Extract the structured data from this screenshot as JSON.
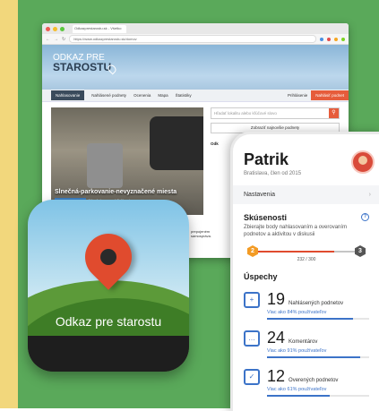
{
  "browser": {
    "tab_title": "Odkazprestarostu.sk - Všetko",
    "url": "https://www.odkazprestarostu.sk/domov",
    "logo_line1": "ODKAZ PRE",
    "logo_line2": "STAROSTU",
    "menu": [
      "Nahlasovanie",
      "Nahlásené podnety",
      "Ocenenia",
      "Mapa",
      "Štatistiky"
    ],
    "login": "Prihlásenie",
    "report_button": "Nahlásiť podnet",
    "search_placeholder": "Hľadať lokalitu alebo kľúčové slovo",
    "latest_button": "Zobraziť najnovšie podnety",
    "hero_caption": "Slnečná-parkovanie-nevyznačené miesta",
    "hero_tag": "Podnet v riešení",
    "hero_meta": "Náměstovo, pred 8 dňami",
    "side_heading": "Odk",
    "foot_text_1": "prepojeném",
    "foot_text_2": "samospráva."
  },
  "app_icon": {
    "label": "Odkaz pre starostu"
  },
  "phone": {
    "name": "Patrik",
    "subtitle": "Bratislava, člen od 2015",
    "settings_label": "Nastavenia",
    "experience_title": "Skúsenosti",
    "experience_desc": "Zbierajte body nahlasovaním a overovaním podnetov a aktivitou v diskusii",
    "level_current": "2",
    "level_next": "3",
    "points": "232 / 300",
    "points_fraction": 0.77,
    "achievements_title": "Úspechy",
    "achievements": [
      {
        "number": "19",
        "label": "Nahlásených podnetov",
        "sub": "Viac ako 84% používateľov",
        "fill": 0.84,
        "icon": "report-add-icon"
      },
      {
        "number": "24",
        "label": "Komentárov",
        "sub": "Viac ako 91% používateľov",
        "fill": 0.91,
        "icon": "comment-icon"
      },
      {
        "number": "12",
        "label": "Overených podnetov",
        "sub": "Viac ako 61% používateľov",
        "fill": 0.61,
        "icon": "verified-icon"
      }
    ]
  }
}
